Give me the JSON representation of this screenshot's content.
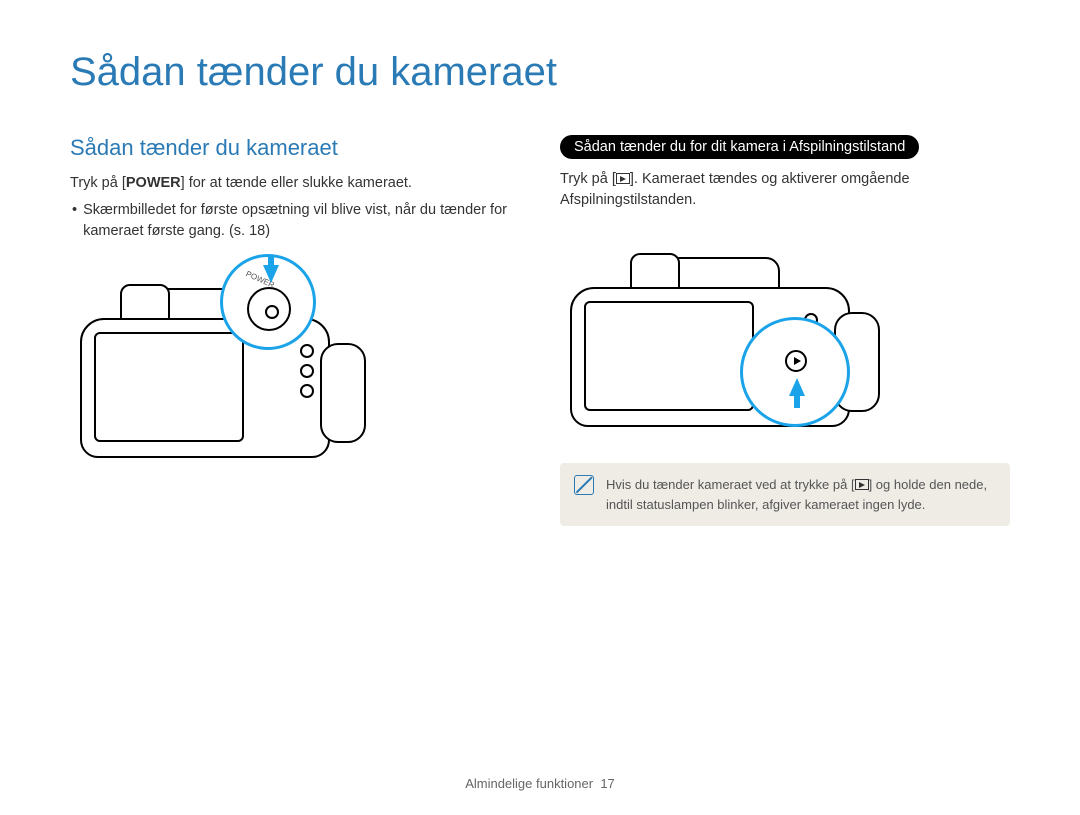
{
  "page_title": "Sådan tænder du kameraet",
  "left": {
    "heading": "Sådan tænder du kameraet",
    "line1_prefix": "Tryk på [",
    "line1_power": "POWER",
    "line1_suffix": "] for at tænde eller slukke kameraet.",
    "bullet1": "Skærmbilledet for første opsætning vil blive vist, når du tænder for kameraet første gang. (s. 18)",
    "figure_power_label": "POWER"
  },
  "right": {
    "capsule": "Sådan tænder du for dit kamera i Afspilningstilstand",
    "line1_prefix": "Tryk på [",
    "line1_suffix": "]. Kameraet tændes og aktiverer omgående Afspilningstilstanden.",
    "note_prefix": "Hvis du tænder kameraet ved at trykke på [",
    "note_suffix": "] og holde den nede, indtil statuslampen blinker, afgiver kameraet ingen lyde."
  },
  "footer": {
    "section": "Almindelige funktioner",
    "page": "17"
  },
  "icons": {
    "playback": "playback-icon",
    "note": "note-icon"
  }
}
